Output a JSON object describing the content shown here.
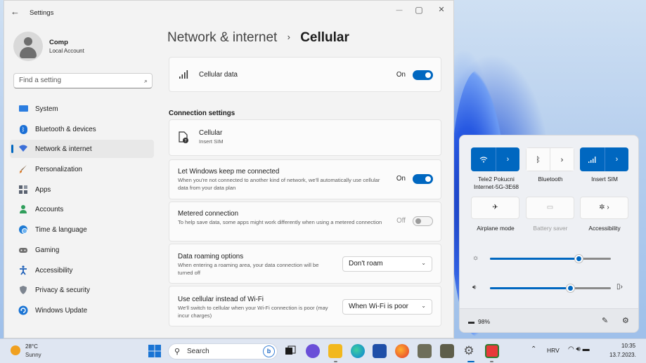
{
  "window": {
    "title": "Settings",
    "back_icon": "←",
    "minimize_glyph": "—",
    "maximize_glyph": "▢",
    "close_glyph": "✕"
  },
  "account": {
    "name": "Comp",
    "type": "Local Account"
  },
  "search": {
    "placeholder": "Find a setting",
    "icon": "⌕"
  },
  "sidebar": {
    "items": [
      {
        "label": "System",
        "icon": "system-icon",
        "color": "#2b7de0",
        "active": false
      },
      {
        "label": "Bluetooth & devices",
        "icon": "bluetooth-icon",
        "color": "#1a6fd6",
        "active": false
      },
      {
        "label": "Network & internet",
        "icon": "wifi-icon",
        "color": "#3b6fd8",
        "active": true
      },
      {
        "label": "Personalization",
        "icon": "brush-icon",
        "color": "#d97b2a",
        "active": false
      },
      {
        "label": "Apps",
        "icon": "apps-icon",
        "color": "#5a6270",
        "active": false
      },
      {
        "label": "Accounts",
        "icon": "person-icon",
        "color": "#2f9e5b",
        "active": false
      },
      {
        "label": "Time & language",
        "icon": "globe-clock-icon",
        "color": "#1f7bd4",
        "active": false
      },
      {
        "label": "Gaming",
        "icon": "controller-icon",
        "color": "#6f6f6f",
        "active": false
      },
      {
        "label": "Accessibility",
        "icon": "accessibility-icon",
        "color": "#1d5fb8",
        "active": false
      },
      {
        "label": "Privacy & security",
        "icon": "shield-icon",
        "color": "#7d8590",
        "active": false
      },
      {
        "label": "Windows Update",
        "icon": "update-icon",
        "color": "#1a74d4",
        "active": false
      }
    ]
  },
  "breadcrumb": {
    "parent": "Network & internet",
    "separator": "›",
    "current": "Cellular"
  },
  "cellular_data": {
    "label": "Cellular data",
    "state": "On",
    "on": true
  },
  "connection_settings": {
    "heading": "Connection settings",
    "cellular": {
      "title": "Cellular",
      "subtitle": "Insert SIM"
    },
    "keep_connected": {
      "title": "Let Windows keep me connected",
      "desc": "When you're not connected to another kind of network, we'll automatically use cellular data from your data plan",
      "state": "On",
      "on": true
    },
    "metered": {
      "title": "Metered connection",
      "desc": "To help save data, some apps might work differently when using a metered connection",
      "state": "Off",
      "on": false
    },
    "roaming": {
      "title": "Data roaming options",
      "desc": "When entering a roaming area, your data connection will be turned off",
      "selected": "Don't roam"
    },
    "cellular_instead": {
      "title": "Use cellular instead of Wi-Fi",
      "desc": "We'll switch to cellular when your Wi-Fi connection is poor (may incur charges)",
      "selected": "When Wi-Fi is poor"
    }
  },
  "quick_settings": {
    "tiles": [
      {
        "label": "Tele2 Pokucni Internet-5G-3E68",
        "active": true
      },
      {
        "label": "Bluetooth",
        "active": false
      },
      {
        "label": "Insert SIM",
        "active": true
      },
      {
        "label": "Airplane mode",
        "active": false
      },
      {
        "label": "Battery saver",
        "active": false,
        "disabled": true
      },
      {
        "label": "Accessibility",
        "active": false
      }
    ],
    "brightness": 0.73,
    "volume": 0.66,
    "battery": "98%",
    "accent": "#0067c0"
  },
  "taskbar": {
    "weather_temp": "28°C",
    "weather_text": "Sunny",
    "search_label": "Search",
    "language": "HRV",
    "time": "10:35",
    "date": "13.7.2023."
  }
}
